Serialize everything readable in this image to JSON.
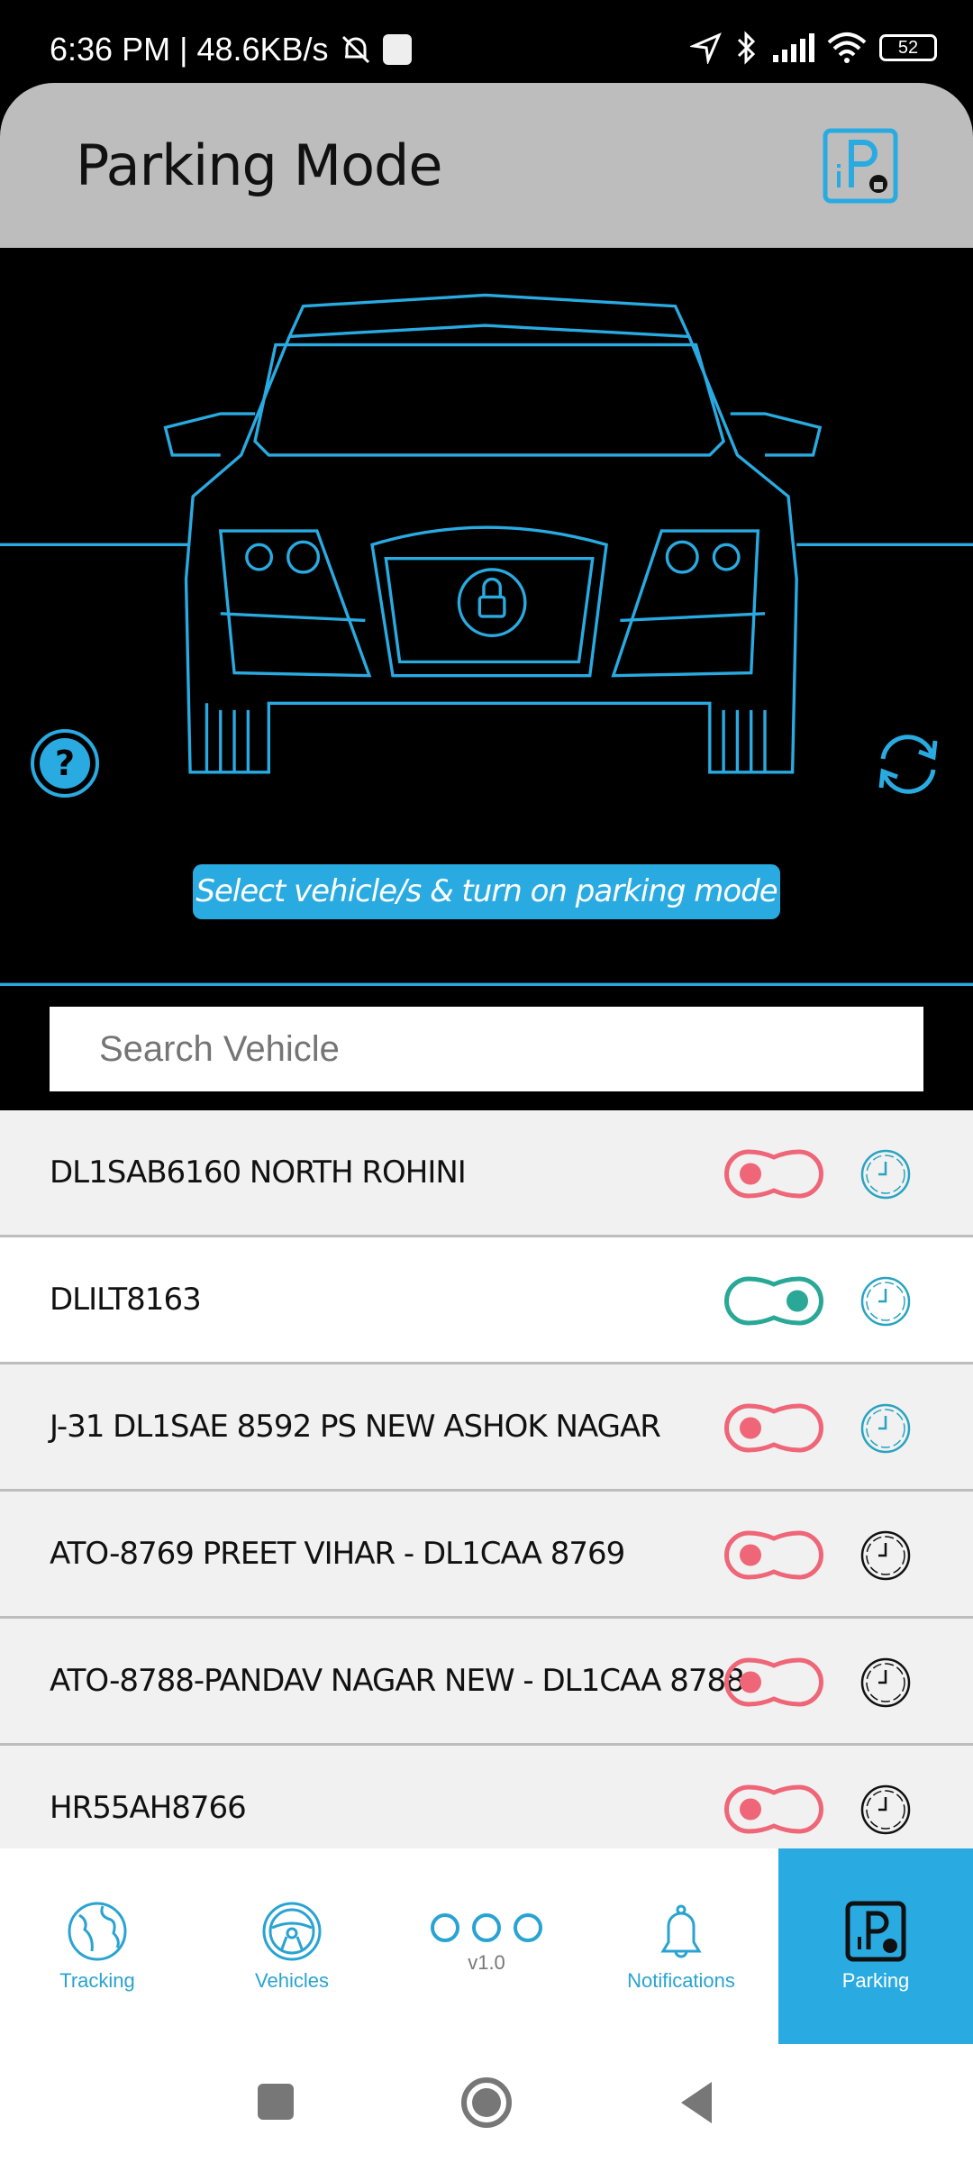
{
  "status_bar": {
    "time": "6:36 PM",
    "net_speed": "48.6KB/s",
    "battery": "52"
  },
  "header": {
    "title": "Parking Mode",
    "icon": "parking-lock-icon"
  },
  "hero": {
    "banner": "Select vehicle/s & turn on parking mode",
    "help_icon": "help-icon",
    "refresh_icon": "refresh-icon",
    "accent": "#29abe2"
  },
  "search": {
    "placeholder": "Search Vehicle",
    "value": ""
  },
  "vehicles": [
    {
      "name": "DL1SAB6160 NORTH ROHINI",
      "parking_on": false,
      "clock_color": "#29a3c0"
    },
    {
      "name": "DLILT8163",
      "parking_on": true,
      "clock_color": "#29a3c0"
    },
    {
      "name": "J-31 DL1SAE 8592 PS NEW ASHOK NAGAR",
      "parking_on": false,
      "clock_color": "#29a3c0"
    },
    {
      "name": "ATO-8769 PREET VIHAR - DL1CAA 8769",
      "parking_on": false,
      "clock_color": "#111111"
    },
    {
      "name": "ATO-8788-PANDAV NAGAR NEW - DL1CAA 8788",
      "parking_on": false,
      "clock_color": "#111111"
    },
    {
      "name": "HR55AH8766",
      "parking_on": false,
      "clock_color": "#111111"
    }
  ],
  "colors": {
    "toggle_off": "#ee6677",
    "toggle_on": "#2aa897"
  },
  "bottom_nav": {
    "items": [
      {
        "label": "Tracking"
      },
      {
        "label": "Vehicles"
      },
      {
        "label": "v1.0"
      },
      {
        "label": "Notifications"
      },
      {
        "label": "Parking",
        "active": true
      }
    ]
  }
}
